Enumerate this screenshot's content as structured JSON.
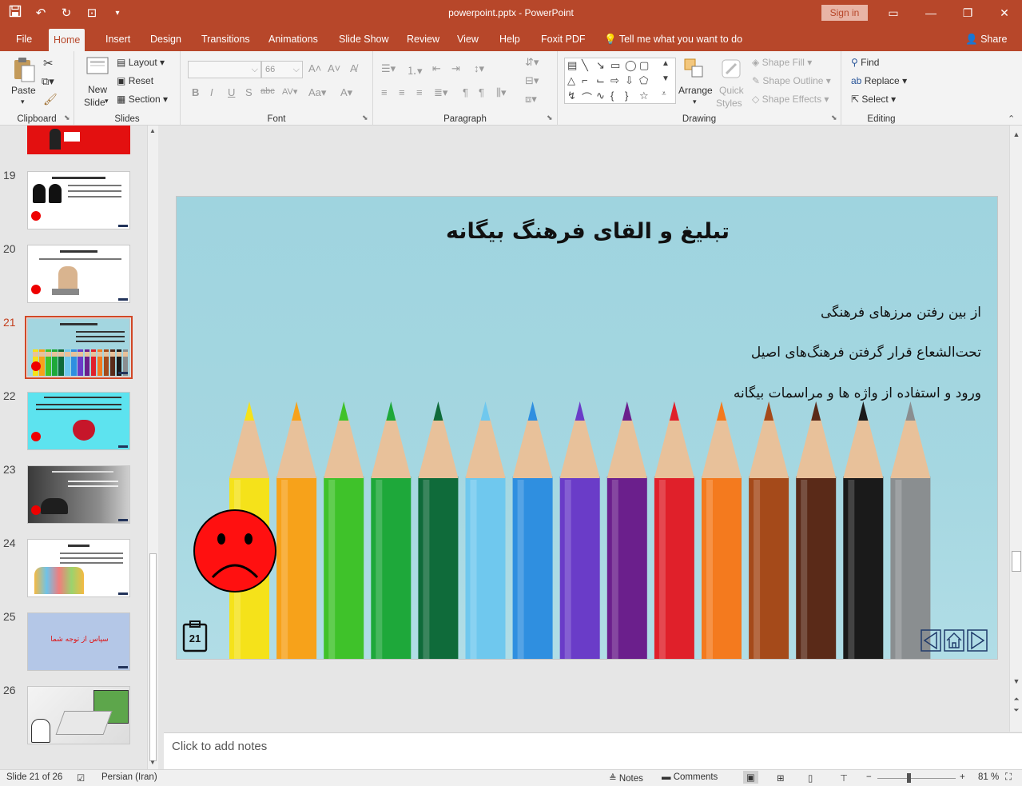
{
  "app": {
    "document_title": "powerpoint.pptx  -  PowerPoint",
    "sign_in": "Sign in",
    "share": "Share",
    "tell_me": "Tell me what you want to do"
  },
  "tabs": [
    "File",
    "Home",
    "Insert",
    "Design",
    "Transitions",
    "Animations",
    "Slide Show",
    "Review",
    "View",
    "Help",
    "Foxit PDF"
  ],
  "active_tab": "Home",
  "ribbon": {
    "clipboard": {
      "label": "Clipboard",
      "paste": "Paste"
    },
    "slides": {
      "label": "Slides",
      "new_slide": "New",
      "new_slide_2": "Slide",
      "layout": "Layout",
      "reset": "Reset",
      "section": "Section"
    },
    "font": {
      "label": "Font",
      "size": "66"
    },
    "paragraph": {
      "label": "Paragraph"
    },
    "drawing": {
      "label": "Drawing",
      "arrange": "Arrange",
      "quick_styles_1": "Quick",
      "quick_styles_2": "Styles",
      "shape_fill": "Shape Fill",
      "shape_outline": "Shape Outline",
      "shape_effects": "Shape Effects"
    },
    "editing": {
      "label": "Editing",
      "find": "Find",
      "replace": "Replace",
      "select": "Select"
    }
  },
  "thumbnails": [
    {
      "num": "19"
    },
    {
      "num": "20"
    },
    {
      "num": "21"
    },
    {
      "num": "22"
    },
    {
      "num": "23"
    },
    {
      "num": "24"
    },
    {
      "num": "25",
      "text": "سپاس از توجه شما"
    },
    {
      "num": "26"
    }
  ],
  "slide": {
    "title": "تبلیغ و القای فرهنگ بیگانه",
    "bullets": [
      "از بین رفتن مرزهای فرهنگی",
      "تحت‌الشعاع قرار گرفتن فرهنگ‌های اصیل",
      "ورود و استفاده از واژه ها و مراسمات بیگانه"
    ],
    "number": "21",
    "pencil_colors": [
      "#f5e21a",
      "#f7a21a",
      "#3fc22a",
      "#1ea83a",
      "#0f6b3a",
      "#6fc8ee",
      "#2f8fe0",
      "#6a3cc8",
      "#6b1f8c",
      "#e0202a",
      "#f47a1e",
      "#a54a1a",
      "#5a2a18",
      "#1a1a1a",
      "#8a8e90"
    ]
  },
  "notes": {
    "placeholder": "Click to add notes"
  },
  "status": {
    "slide_info": "Slide 21 of 26",
    "language": "Persian (Iran)",
    "notes": "Notes",
    "comments": "Comments",
    "zoom": "81 %"
  }
}
